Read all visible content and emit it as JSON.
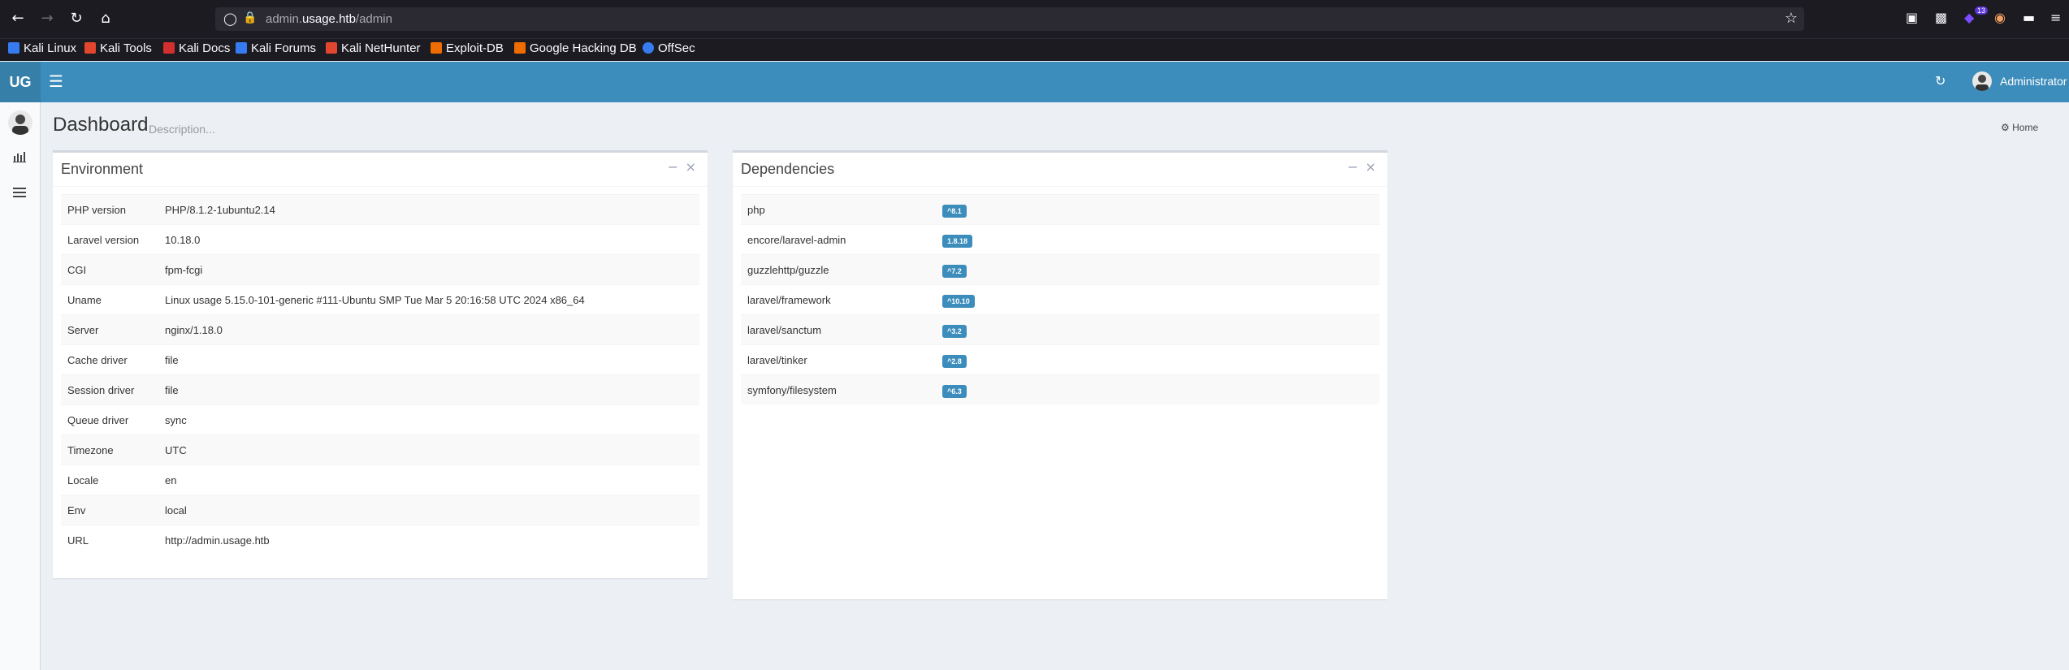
{
  "browser": {
    "url_prefix": "admin.",
    "url_host": "usage.htb",
    "url_path": "/admin",
    "extension_badge": "13"
  },
  "bookmarks": [
    {
      "label": "Kali Linux",
      "icon": "kali-icon",
      "color": "#367bf0"
    },
    {
      "label": "Kali Tools",
      "icon": "kali-tools-icon",
      "color": "#e2462f"
    },
    {
      "label": "Kali Docs",
      "icon": "kali-docs-icon",
      "color": "#d32f2f"
    },
    {
      "label": "Kali Forums",
      "icon": "kali-forums-icon",
      "color": "#367bf0"
    },
    {
      "label": "Kali NetHunter",
      "icon": "nethunter-icon",
      "color": "#e2462f"
    },
    {
      "label": "Exploit-DB",
      "icon": "exploit-db-icon",
      "color": "#ef6c00"
    },
    {
      "label": "Google Hacking DB",
      "icon": "ghdb-icon",
      "color": "#ef6c00"
    },
    {
      "label": "OffSec",
      "icon": "offsec-icon",
      "color": "#367bf0"
    }
  ],
  "header": {
    "logo": "UG",
    "user_name": "Administrator"
  },
  "page": {
    "title": "Dashboard",
    "description": "Description...",
    "breadcrumb": "Home"
  },
  "environment": {
    "title": "Environment",
    "rows": [
      {
        "key": "PHP version",
        "value": "PHP/8.1.2-1ubuntu2.14"
      },
      {
        "key": "Laravel version",
        "value": "10.18.0"
      },
      {
        "key": "CGI",
        "value": "fpm-fcgi"
      },
      {
        "key": "Uname",
        "value": "Linux usage 5.15.0-101-generic #111-Ubuntu SMP Tue Mar 5 20:16:58 UTC 2024 x86_64"
      },
      {
        "key": "Server",
        "value": "nginx/1.18.0"
      },
      {
        "key": "Cache driver",
        "value": "file"
      },
      {
        "key": "Session driver",
        "value": "file"
      },
      {
        "key": "Queue driver",
        "value": "sync"
      },
      {
        "key": "Timezone",
        "value": "UTC"
      },
      {
        "key": "Locale",
        "value": "en"
      },
      {
        "key": "Env",
        "value": "local"
      },
      {
        "key": "URL",
        "value": "http://admin.usage.htb"
      }
    ]
  },
  "dependencies": {
    "title": "Dependencies",
    "rows": [
      {
        "name": "php",
        "version": "^8.1"
      },
      {
        "name": "encore/laravel-admin",
        "version": "1.8.18"
      },
      {
        "name": "guzzlehttp/guzzle",
        "version": "^7.2"
      },
      {
        "name": "laravel/framework",
        "version": "^10.10"
      },
      {
        "name": "laravel/sanctum",
        "version": "^3.2"
      },
      {
        "name": "laravel/tinker",
        "version": "^2.8"
      },
      {
        "name": "symfony/filesystem",
        "version": "^6.3"
      }
    ]
  },
  "colors": {
    "header": "#3c8dbc",
    "logo_bg": "#367fa9",
    "badge": "#3c8dbc",
    "content_bg": "#ecf0f5"
  }
}
